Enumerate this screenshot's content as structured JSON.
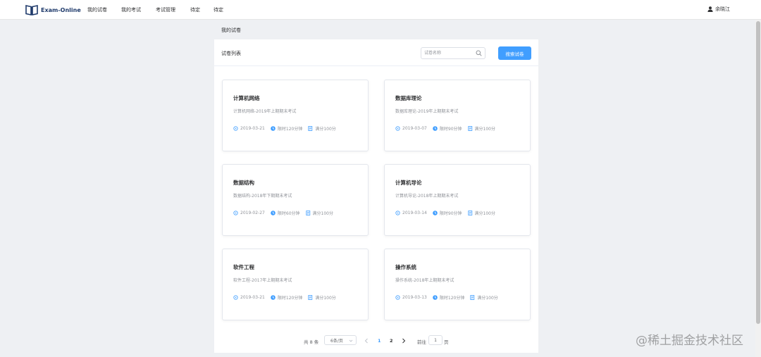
{
  "brand": {
    "name": "Exam-Online",
    "icon": "open-book-icon"
  },
  "nav": {
    "items": [
      {
        "label": "我的试卷"
      },
      {
        "label": "我的考试"
      },
      {
        "label": "考试管理"
      },
      {
        "label": "待定"
      },
      {
        "label": "待定"
      }
    ],
    "user": {
      "name": "余晓江",
      "icon": "user-icon"
    }
  },
  "page_title": "我的试卷",
  "panel": {
    "title": "试卷列表",
    "search": {
      "placeholder": "试卷名称",
      "value": ""
    },
    "search_button": "搜索试卷"
  },
  "papers": [
    {
      "title": "计算机网络",
      "desc": "计算机网络-2019年上期期末考试",
      "date": "2019-03-21",
      "duration": "限时120分钟",
      "score": "满分100分"
    },
    {
      "title": "数据库理论",
      "desc": "数据库理论-2019年上期期末考试",
      "date": "2019-03-07",
      "duration": "限时90分钟",
      "score": "满分100分"
    },
    {
      "title": "数据结构",
      "desc": "数据结构-2018年下期期末考试",
      "date": "2019-02-27",
      "duration": "限时60分钟",
      "score": "满分100分"
    },
    {
      "title": "计算机导论",
      "desc": "计算机导论-2018年上期期末考试",
      "date": "2019-03-14",
      "duration": "限时90分钟",
      "score": "满分100分"
    },
    {
      "title": "软件工程",
      "desc": "软件工程-2017年上期期末考试",
      "date": "2019-03-21",
      "duration": "限时120分钟",
      "score": "满分100分"
    },
    {
      "title": "操作系统",
      "desc": "操作系统-2018年上期期末考试",
      "date": "2019-03-13",
      "duration": "限时120分钟",
      "score": "满分100分"
    }
  ],
  "pagination": {
    "total": "共 8 条",
    "page_size": "6条/页",
    "pages": [
      "1",
      "2"
    ],
    "current_page": "1",
    "goto_label": "前往",
    "goto_value": "1",
    "page_unit": "页"
  },
  "watermark": "@稀土掘金技术社区",
  "colors": {
    "primary": "#409eff",
    "page_bg": "#eef0f3",
    "brand": "#1f3a6b"
  }
}
